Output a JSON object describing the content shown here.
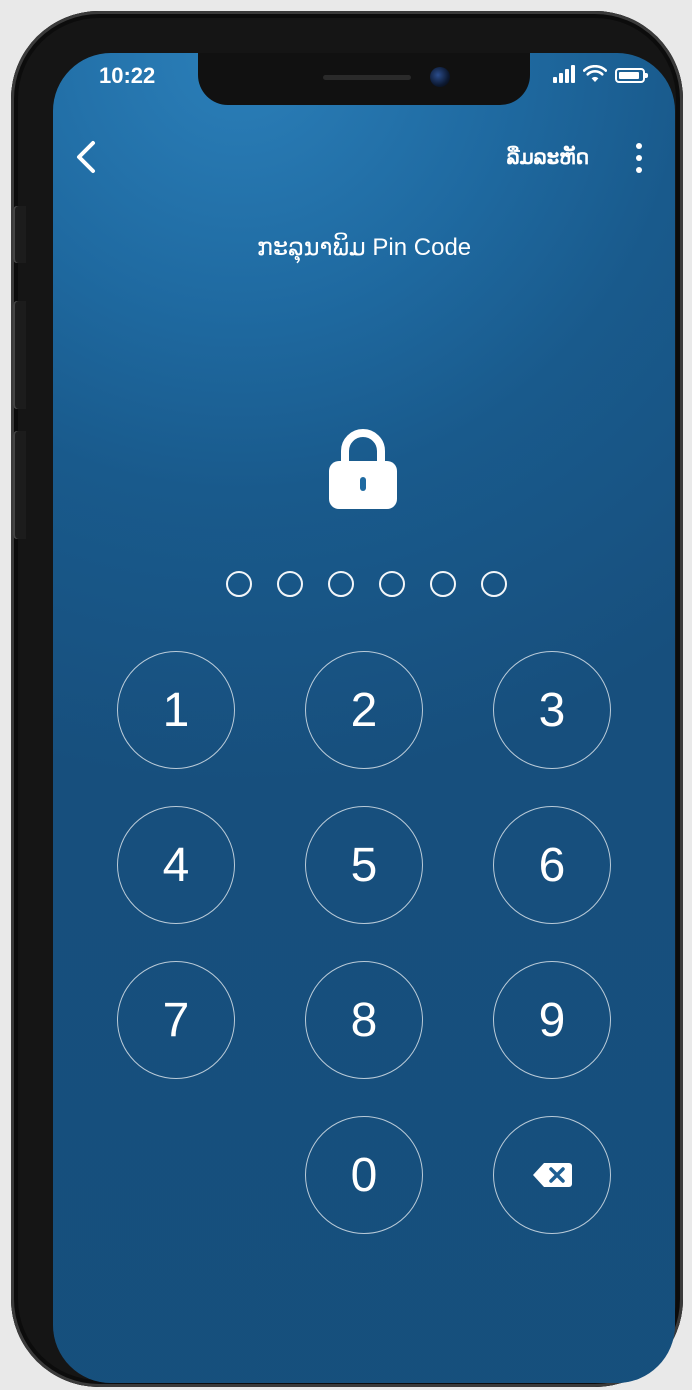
{
  "status_bar": {
    "time": "10:22",
    "icons": [
      "cellular-signal-icon",
      "wifi-icon",
      "battery-icon"
    ]
  },
  "header": {
    "back_icon": "chevron-left-icon",
    "forgot_label": "ລືມລະຫັດ",
    "menu_icon": "vertical-ellipsis-icon"
  },
  "prompt": "ກະລຸນາພິມ Pin Code",
  "lock_icon": "padlock-icon",
  "pin": {
    "length": 6,
    "entered": 0
  },
  "keypad": {
    "keys": [
      "1",
      "2",
      "3",
      "4",
      "5",
      "6",
      "7",
      "8",
      "9",
      "",
      "0",
      "backspace"
    ],
    "delete_icon": "backspace-icon"
  },
  "colors": {
    "background_top": "#2b7fb9",
    "background_bottom": "#174f7d",
    "foreground": "#ffffff",
    "device_frame": "#151515"
  }
}
